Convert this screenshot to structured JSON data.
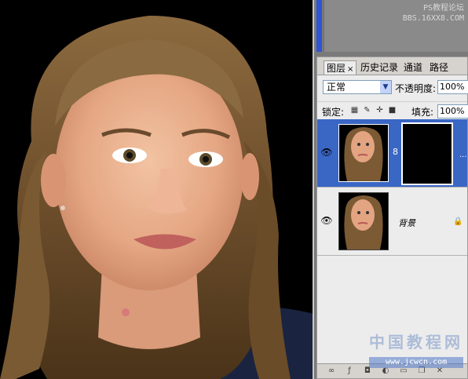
{
  "canvas": {
    "image_alt": "portrait photo"
  },
  "watermark_top": {
    "line1": "PS教程论坛",
    "line2": "BBS.16XX8.COM"
  },
  "layers_panel": {
    "tabs": [
      {
        "label": "图层",
        "active": true,
        "has_close": true
      },
      {
        "label": "历史记录"
      },
      {
        "label": "通道"
      },
      {
        "label": "路径"
      }
    ],
    "tab_close": "×",
    "blend_mode": "正常",
    "blend_arrow": "▼",
    "opacity_label": "不透明度:",
    "opacity_value": "100%",
    "lock_label": "锁定:",
    "fill_label": "填充:",
    "fill_value": "100%",
    "layers": [
      {
        "name": "",
        "selected": true,
        "has_mask": true,
        "visible": true
      },
      {
        "name": "背景",
        "selected": false,
        "locked": true,
        "visible": true
      }
    ],
    "eye": "👁",
    "chain": "8",
    "more": "...",
    "lock_glyph": "🔒"
  },
  "watermark": {
    "text": "中国教程网",
    "url": "www.jcwcn.com"
  }
}
